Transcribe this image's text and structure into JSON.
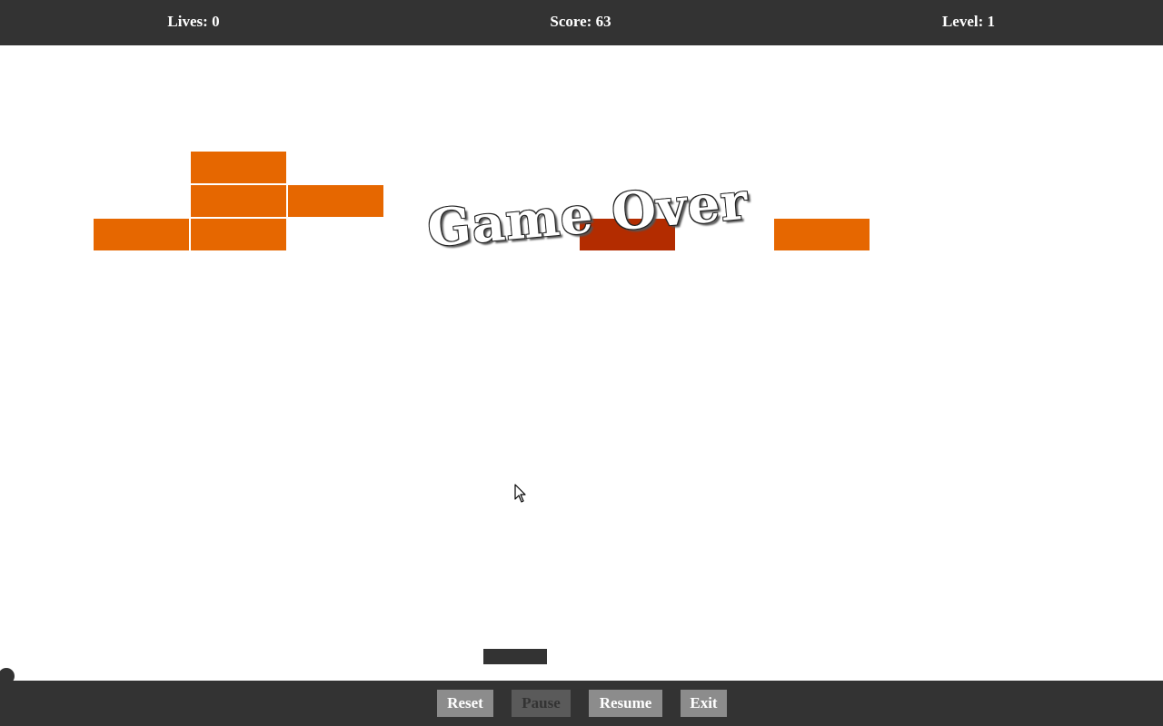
{
  "hud": {
    "lives": "Lives: 0",
    "score": "Score: 63",
    "level": "Level: 1"
  },
  "overlay": {
    "message": "Game Over"
  },
  "bricks": [
    {
      "state": "intact",
      "color": "#e66700"
    },
    {
      "state": "intact",
      "color": "#e66700"
    },
    {
      "state": "intact",
      "color": "#e66700"
    },
    {
      "state": "intact",
      "color": "#e66700"
    },
    {
      "state": "intact",
      "color": "#e66700"
    },
    {
      "state": "hardened",
      "color": "#b32c00"
    },
    {
      "state": "intact",
      "color": "#e66700"
    }
  ],
  "controls": {
    "reset": "Reset",
    "pause": "Pause",
    "resume": "Resume",
    "exit": "Exit"
  },
  "colors": {
    "bar_background": "#333333",
    "button_background": "#8c8c8c",
    "button_disabled_background": "#5a5a5a",
    "brick": "#e66700",
    "brick_hardened": "#b32c00"
  }
}
